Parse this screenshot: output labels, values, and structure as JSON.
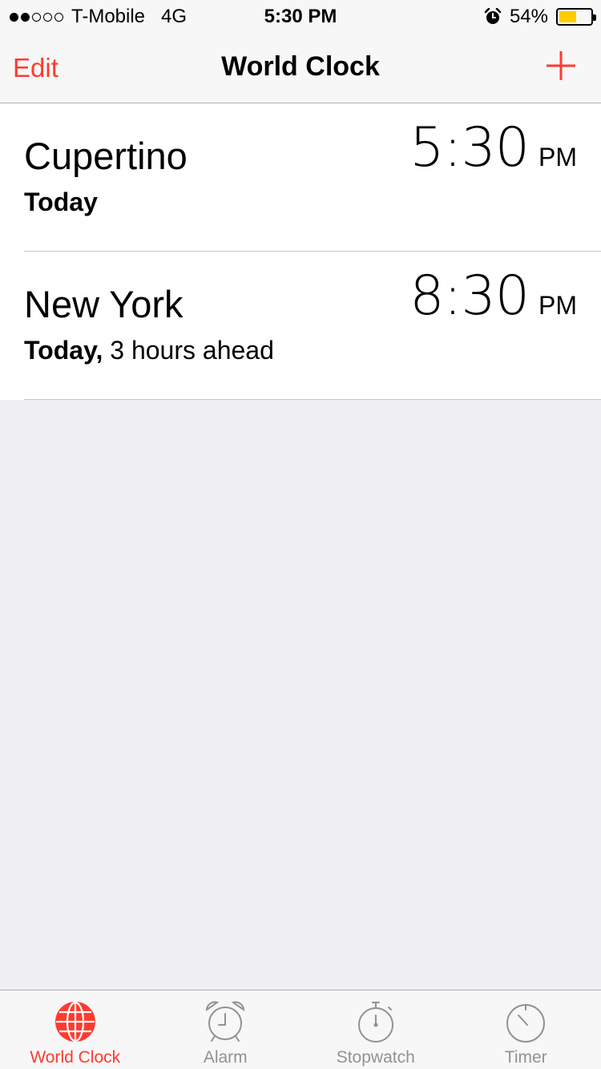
{
  "status_bar": {
    "signal_bars_filled": 2,
    "signal_bars_total": 5,
    "carrier": "T-Mobile",
    "network": "4G",
    "time": "5:30 PM",
    "alarm_icon": "alarm-clock-icon",
    "battery_percent": "54%",
    "battery_level": 0.54,
    "battery_color": "#ffcc00"
  },
  "nav": {
    "edit_label": "Edit",
    "title": "World Clock",
    "add_icon": "plus-icon",
    "accent_color": "#ff3b30"
  },
  "clocks": [
    {
      "city": "Cupertino",
      "day": "Today",
      "offset": "",
      "time": "5:30",
      "ampm": "PM"
    },
    {
      "city": "New York",
      "day": "Today,",
      "offset": "3 hours ahead",
      "time": "8:30",
      "ampm": "PM"
    }
  ],
  "tabs": [
    {
      "label": "World Clock",
      "icon": "globe-icon",
      "active": true
    },
    {
      "label": "Alarm",
      "icon": "alarm-clock-icon",
      "active": false
    },
    {
      "label": "Stopwatch",
      "icon": "stopwatch-icon",
      "active": false
    },
    {
      "label": "Timer",
      "icon": "timer-icon",
      "active": false
    }
  ]
}
